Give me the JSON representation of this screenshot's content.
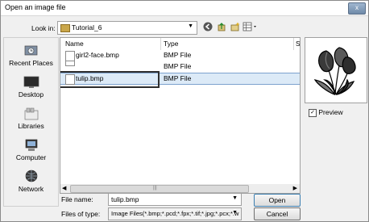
{
  "window": {
    "title": "Open an image file",
    "close_label": "x"
  },
  "lookin": {
    "label": "Look in:",
    "value": "Tutorial_6"
  },
  "places": [
    {
      "label": "Recent Places",
      "icon": "recent-places-icon"
    },
    {
      "label": "Desktop",
      "icon": "desktop-icon"
    },
    {
      "label": "Libraries",
      "icon": "libraries-icon"
    },
    {
      "label": "Computer",
      "icon": "computer-icon"
    },
    {
      "label": "Network",
      "icon": "network-icon"
    }
  ],
  "filelist": {
    "columns": [
      "Name",
      "Type",
      "S"
    ],
    "rows": [
      {
        "name": "girl2-face.bmp",
        "type": "BMP File"
      },
      {
        "name": "",
        "type": "BMP File"
      },
      {
        "name": "tulip.bmp",
        "type": "BMP File"
      }
    ],
    "selected_index": 2
  },
  "preview": {
    "label": "Preview",
    "checked": true,
    "check_glyph": "✓"
  },
  "filename": {
    "label": "File name:",
    "value": "tulip.bmp"
  },
  "filetype": {
    "label": "Files of type:",
    "value": "Image Files(*.bmp;*.pcd;*.fpx;*.tif;*.jpg;*.pcx;*.w"
  },
  "buttons": {
    "open": "Open",
    "cancel": "Cancel"
  },
  "colors": {
    "selection_bg": "#dceaf7",
    "selection_border": "#7da2ce",
    "tulip_fill": "#3a3a3a"
  }
}
